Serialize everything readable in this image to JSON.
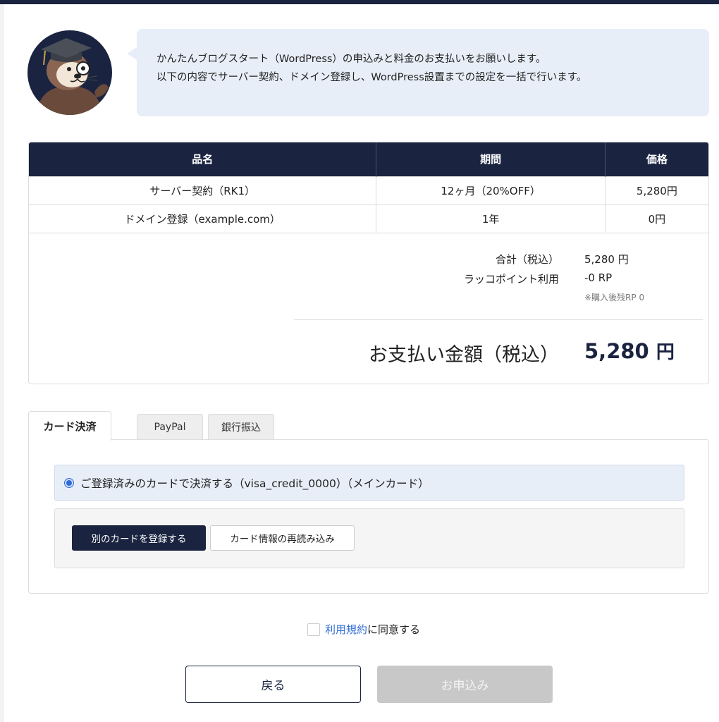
{
  "intro": {
    "line1": "かんたんブログスタート（WordPress）の申込みと料金のお支払いをお願いします。",
    "line2": "以下の内容でサーバー契約、ドメイン登録し、WordPress設置までの設定を一括で行います。"
  },
  "order_table": {
    "headers": [
      "品名",
      "期間",
      "価格"
    ],
    "rows": [
      [
        "サーバー契約（RK1）",
        "12ヶ月（20%OFF）",
        "5,280円"
      ],
      [
        "ドメイン登録（example.com）",
        "1年",
        "0円"
      ]
    ]
  },
  "summary": {
    "total_label": "合計（税込）",
    "total_value": "5,280 円",
    "points_label": "ラッコポイント利用",
    "points_value": "-0 RP",
    "points_note": "※購入後残RP 0",
    "payment_label": "お支払い金額（税込）",
    "payment_amount": "5,280",
    "payment_unit": "円"
  },
  "payment_tabs": {
    "tabs": [
      "カード決済",
      "PayPal",
      "銀行振込"
    ],
    "active": "カード決済"
  },
  "card": {
    "registered_option": "ご登録済みのカードで決済する（visa_credit_0000）（メインカード）",
    "register_new_button": "別のカードを登録する",
    "reload_button": "カード情報の再読み込み"
  },
  "agree": {
    "link_text": "利用規約",
    "suffix": "に同意する",
    "checked": false
  },
  "actions": {
    "back_label": "戻る",
    "apply_label": "お申込み"
  },
  "colors": {
    "navy": "#1a2440",
    "accent_blue": "#2f6cd6",
    "bubble_bg": "#e8eef8",
    "disabled_gray": "#c8c8c8"
  }
}
